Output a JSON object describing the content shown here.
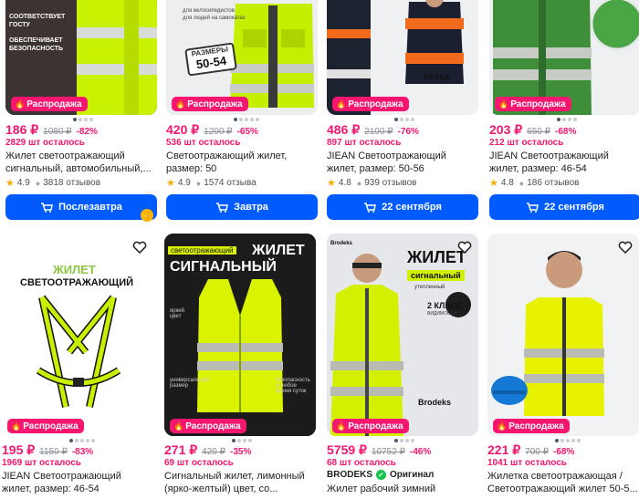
{
  "sale_label": "Распродажа",
  "row1": [
    {
      "price": "186 ₽",
      "old_price": "1080 ₽",
      "discount": "-82%",
      "stock": "2829 шт осталось",
      "title": "Жилет светоотражающий сигнальный, автомобильный,...",
      "rating": "4.9",
      "reviews": "3818 отзывов",
      "delivery": "Послезавтра"
    },
    {
      "price": "420 ₽",
      "old_price": "1200 ₽",
      "discount": "-65%",
      "stock": "536 шт осталось",
      "title": "Светоотражающий жилет, размер: 50",
      "rating": "4.9",
      "reviews": "1574 отзыва",
      "delivery": "Завтра"
    },
    {
      "price": "486 ₽",
      "old_price": "2100 ₽",
      "discount": "-76%",
      "stock": "897 шт осталось",
      "title": "JIEAN Светоотражающий жилет, размер: 50-56",
      "rating": "4.8",
      "reviews": "939 отзывов",
      "delivery": "22 сентября"
    },
    {
      "price": "203 ₽",
      "old_price": "650 ₽",
      "discount": "-68%",
      "stock": "212 шт осталось",
      "title": "JIEAN Светоотражающий жилет, размер: 46-54",
      "rating": "4.8",
      "reviews": "186 отзывов",
      "delivery": "22 сентября"
    }
  ],
  "row2": [
    {
      "price": "195 ₽",
      "old_price": "1150 ₽",
      "discount": "-83%",
      "stock": "1969 шт осталось",
      "title": "JIEAN Светоотражающий жилет, размер: 46-54"
    },
    {
      "price": "271 ₽",
      "old_price": "420 ₽",
      "discount": "-35%",
      "stock": "69 шт осталось",
      "title": "Сигнальный жилет, лимонный (ярко-желтый) цвет, со..."
    },
    {
      "price": "5759 ₽",
      "old_price": "10752 ₽",
      "discount": "-46%",
      "stock": "68 шт осталось",
      "brand": "BRODEKS",
      "original": "Оригинал",
      "title": "Жилет рабочий зимний"
    },
    {
      "price": "221 ₽",
      "old_price": "700 ₽",
      "discount": "-68%",
      "stock": "1041 шт осталось",
      "title": "Жилетка светоотражающая / Светоотражающий жилет 50-5..."
    }
  ],
  "image_text": {
    "c1": [
      "СООТВЕТСТВУЕТ",
      "ГОСТУ",
      "ОБЕСПЕЧИВАЕТ",
      "БЕЗОПАСНОСТЬ"
    ],
    "c2": [
      "для велосипедистов",
      "для людей на самокатах",
      "РАЗМЕРЫ",
      "50-54"
    ],
    "c3": [
      "НАЗАД"
    ],
    "c5": [
      "ЖИЛЕТ",
      "СВЕТООТРАЖАЮЩИЙ"
    ],
    "c6": [
      "светоотражающий",
      "ЖИЛЕТ",
      "СИГНАЛЬНЫЙ",
      "яркий цвет",
      "универсальный размер",
      "безопасность в любое время суток"
    ],
    "c7": [
      "Brodeks",
      "ЖИЛЕТ",
      "сигнальный",
      "утепленный",
      "2 КЛАСС",
      "ВИДИМОСТИ",
      "Brodeks"
    ]
  },
  "colors": {
    "accent": "#005bff",
    "sale": "#f5166f",
    "vest": "#c8f000"
  }
}
